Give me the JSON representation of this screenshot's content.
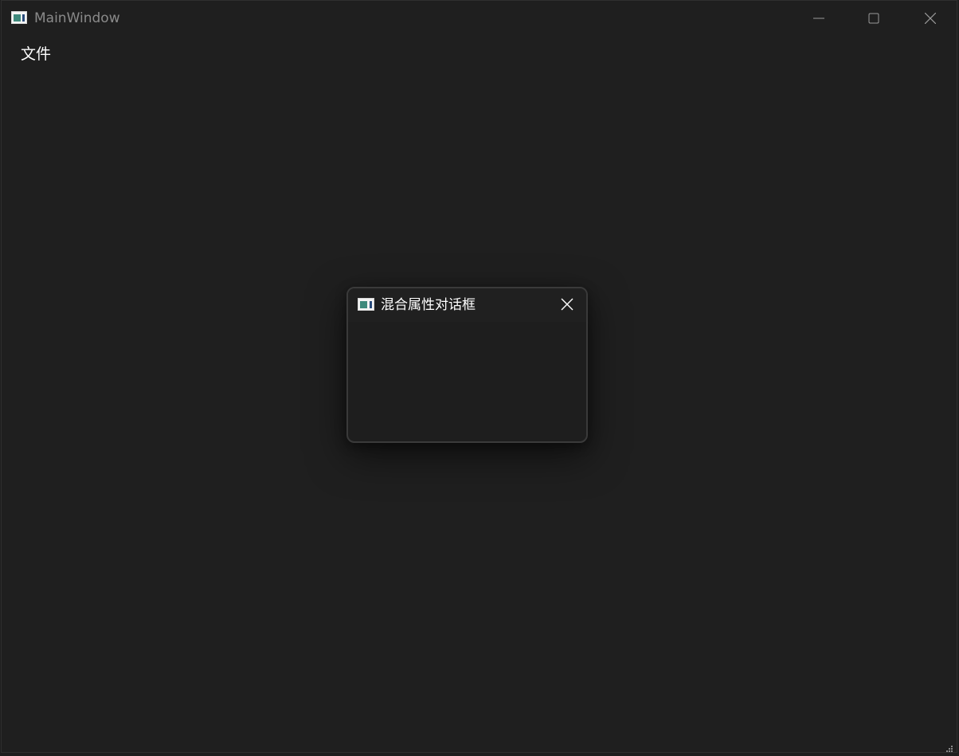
{
  "window": {
    "title": "MainWindow",
    "icon": "app-window-icon",
    "controls": [
      "minimize-icon",
      "maximize-icon",
      "close-icon"
    ]
  },
  "menubar": {
    "items": [
      {
        "label": "文件"
      }
    ]
  },
  "dialog": {
    "title": "混合属性对话框",
    "icon": "app-window-icon",
    "controls": [
      "close-icon"
    ]
  },
  "colors": {
    "background": "#1f1f1f",
    "title_inactive": "#8a8a8a",
    "text": "#ffffff",
    "dialog_border": "#3a3a3a"
  }
}
